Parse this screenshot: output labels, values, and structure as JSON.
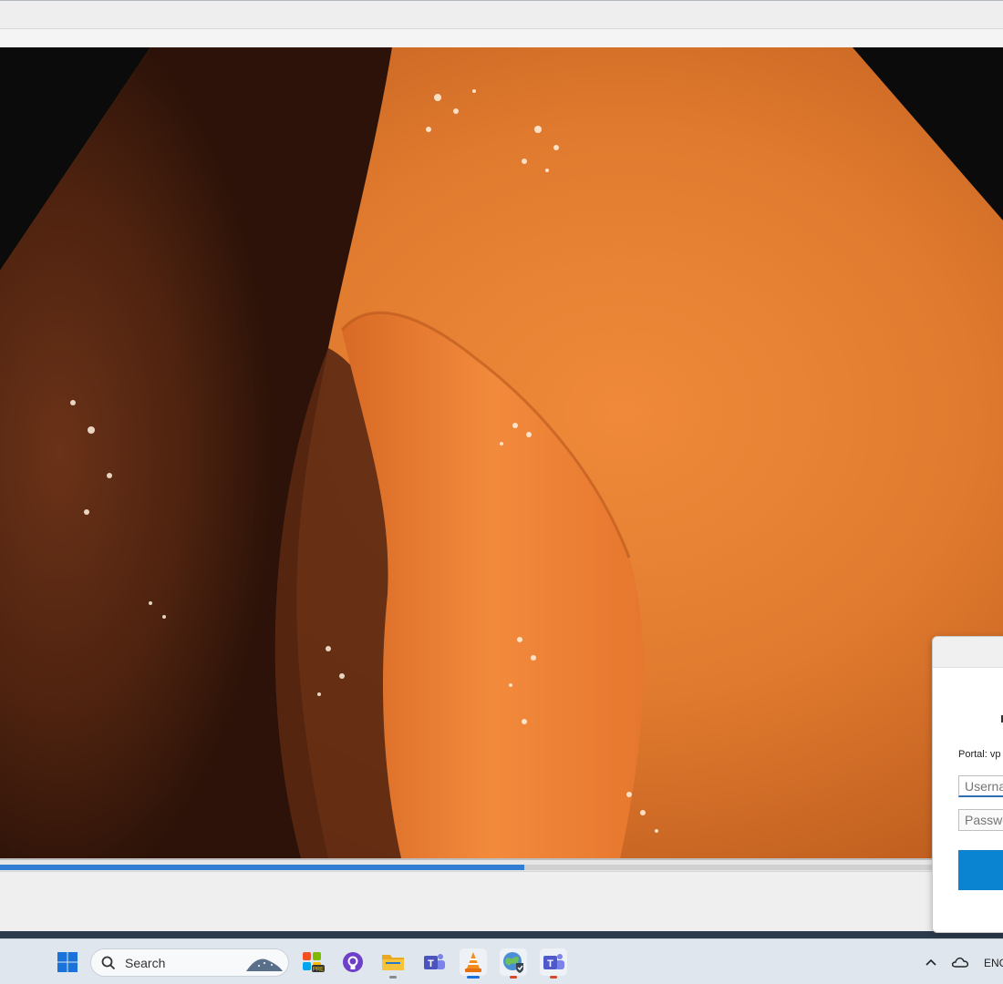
{
  "player": {
    "progress_fraction": 0.523,
    "accent_color": "#2f7ed2"
  },
  "login_dialog": {
    "portal_label": "Portal: vp",
    "username_placeholder": "Userna",
    "password_placeholder": "Passwo",
    "button_color": "#0a83d1"
  },
  "taskbar": {
    "search_label": "Search",
    "tray_language": "ENG",
    "icons": [
      "windows-start-icon",
      "search-icon",
      "copilot-pre-icon",
      "github-icon",
      "file-explorer-icon",
      "teams-icon",
      "vlc-icon",
      "globalprotect-icon",
      "teams-new-icon",
      "chevron-up-icon",
      "onedrive-cloud-icon"
    ]
  }
}
